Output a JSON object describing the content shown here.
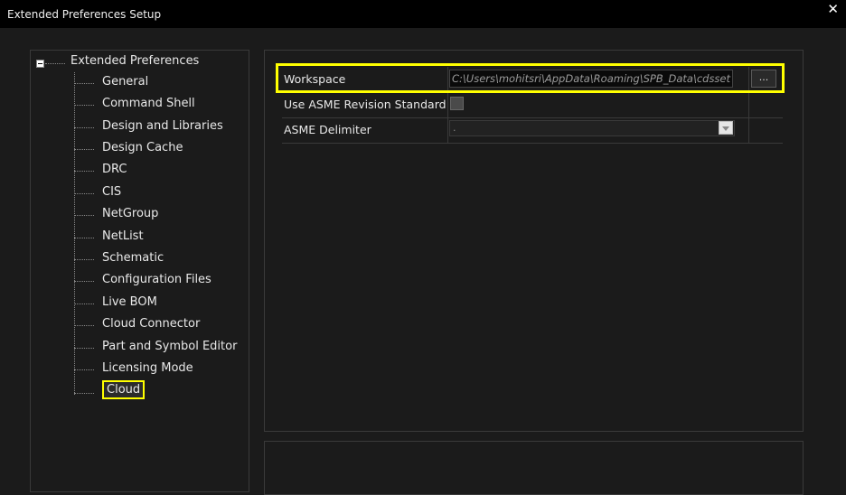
{
  "window": {
    "title": "Extended Preferences Setup",
    "close_icon": "close-icon"
  },
  "tree": {
    "root_label": "Extended Preferences",
    "items": [
      {
        "label": "General"
      },
      {
        "label": "Command Shell"
      },
      {
        "label": "Design and Libraries"
      },
      {
        "label": "Design Cache"
      },
      {
        "label": "DRC"
      },
      {
        "label": "CIS"
      },
      {
        "label": "NetGroup"
      },
      {
        "label": "NetList"
      },
      {
        "label": "Schematic"
      },
      {
        "label": "Configuration Files"
      },
      {
        "label": "Live BOM"
      },
      {
        "label": "Cloud Connector"
      },
      {
        "label": "Part and Symbol Editor"
      },
      {
        "label": "Licensing Mode"
      },
      {
        "label": "Cloud",
        "selected": true
      }
    ]
  },
  "properties": {
    "workspace": {
      "label": "Workspace",
      "value": "C:\\Users\\mohitsri\\AppData\\Roaming\\SPB_Data\\cdsset",
      "browse_label": "..."
    },
    "asme_revision": {
      "label": "Use ASME Revision Standard",
      "checked": false
    },
    "asme_delimiter": {
      "label": "ASME Delimiter",
      "value": "."
    }
  },
  "colors": {
    "highlight": "#ffff00",
    "background": "#1b1b1b",
    "titlebar": "#000000"
  }
}
